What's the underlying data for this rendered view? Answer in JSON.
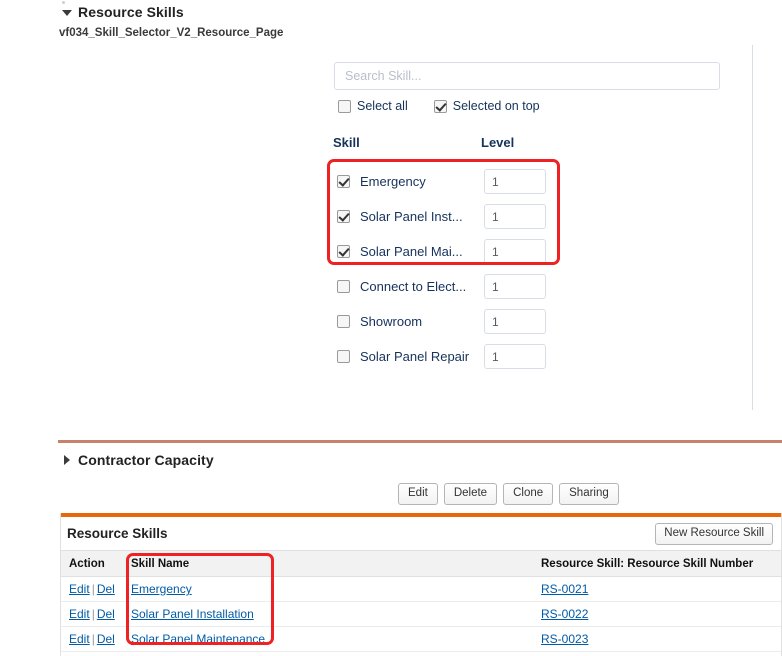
{
  "vf_section": {
    "title": "Resource Skills",
    "page_name": "vf034_Skill_Selector_V2_Resource_Page",
    "search": {
      "placeholder": "Search Skill...",
      "value": ""
    },
    "options": [
      {
        "label": "Select all",
        "checked": false
      },
      {
        "label": "Selected on top",
        "checked": true
      }
    ],
    "columns": {
      "skill": "Skill",
      "level": "Level"
    },
    "skills": [
      {
        "name": "Emergency",
        "checked": true,
        "level": "1"
      },
      {
        "name": "Solar Panel Inst...",
        "checked": true,
        "level": "1"
      },
      {
        "name": "Solar Panel Mai...",
        "checked": true,
        "level": "1"
      },
      {
        "name": "Connect to Elect...",
        "checked": false,
        "level": "1"
      },
      {
        "name": "Showroom",
        "checked": false,
        "level": "1"
      },
      {
        "name": "Solar Panel Repair",
        "checked": false,
        "level": "1"
      }
    ]
  },
  "contractor_capacity": {
    "title": "Contractor Capacity",
    "expanded": false
  },
  "record_buttons": [
    "Edit",
    "Delete",
    "Clone",
    "Sharing"
  ],
  "related_list": {
    "title": "Resource Skills",
    "new_button": "New Resource Skill",
    "headers": {
      "action": "Action",
      "skill_name": "Skill Name",
      "resource_skill_number": "Resource Skill: Resource Skill Number"
    },
    "action_edit": "Edit",
    "action_del": "Del",
    "action_separator": "|",
    "rows": [
      {
        "skill_name": "Emergency",
        "resource_skill_number": "RS-0021"
      },
      {
        "skill_name": "Solar Panel Installation",
        "resource_skill_number": "RS-0022"
      },
      {
        "skill_name": "Solar Panel Maintenance",
        "resource_skill_number": "RS-0023"
      }
    ]
  },
  "annotations": {
    "highlight_color": "#ee2222",
    "accent_orange": "#e8670c",
    "divider_orange": "#c8816a",
    "link_color": "#015ba7"
  }
}
